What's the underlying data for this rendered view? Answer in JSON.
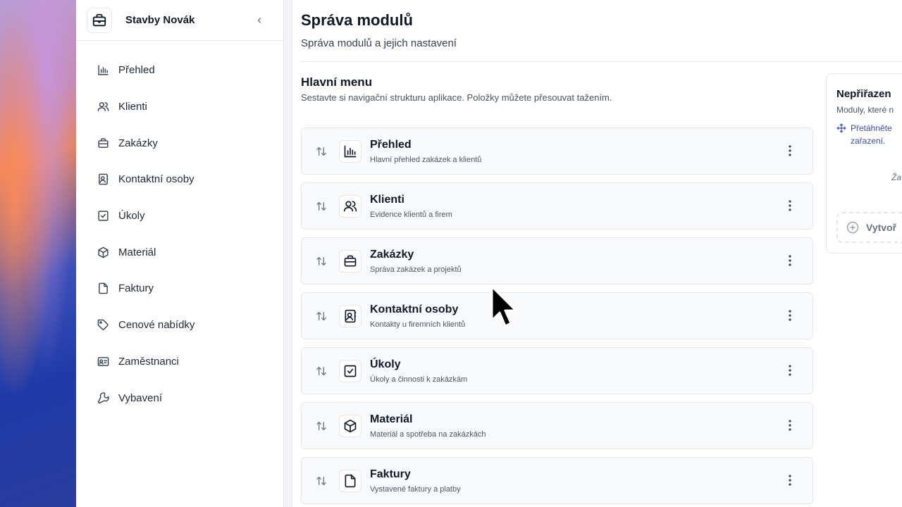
{
  "company": "Stavby Novák",
  "sidebar": {
    "items": [
      {
        "label": "Přehled",
        "icon": "chart-icon"
      },
      {
        "label": "Klienti",
        "icon": "users-icon"
      },
      {
        "label": "Zakázky",
        "icon": "briefcase-icon"
      },
      {
        "label": "Kontaktní osoby",
        "icon": "contact-book-icon"
      },
      {
        "label": "Úkoly",
        "icon": "checkbox-icon"
      },
      {
        "label": "Materiál",
        "icon": "box-icon"
      },
      {
        "label": "Faktury",
        "icon": "file-icon"
      },
      {
        "label": "Cenové nabídky",
        "icon": "tag-icon"
      },
      {
        "label": "Zaměstnanci",
        "icon": "id-card-icon"
      },
      {
        "label": "Vybavení",
        "icon": "wrench-icon"
      }
    ]
  },
  "page": {
    "title": "Správa modulů",
    "subtitle": "Správa modulů a jejich nastavení"
  },
  "main_menu": {
    "title": "Hlavní menu",
    "description": "Sestavte si navigační strukturu aplikace. Položky můžete přesouvat tažením.",
    "modules": [
      {
        "title": "Přehled",
        "description": "Hlavní přehled zakázek a klientů",
        "icon": "chart-icon"
      },
      {
        "title": "Klienti",
        "description": "Evidence klientů a firem",
        "icon": "users-icon"
      },
      {
        "title": "Zakázky",
        "description": "Správa zakázek a projektů",
        "icon": "briefcase-icon"
      },
      {
        "title": "Kontaktní osoby",
        "description": "Kontakty u firemních klientů",
        "icon": "contact-book-icon"
      },
      {
        "title": "Úkoly",
        "description": "Úkoly a činnosti k zakázkám",
        "icon": "checkbox-icon"
      },
      {
        "title": "Materiál",
        "description": "Materiál a spotřeba na zakázkách",
        "icon": "box-icon"
      },
      {
        "title": "Faktury",
        "description": "Vystavené faktury a platby",
        "icon": "file-icon"
      }
    ]
  },
  "unassigned": {
    "title": "Nepřiřazen",
    "description": "Moduly, které n",
    "hint_line1": "Přetáhněte",
    "hint_line2": "zařazení.",
    "empty": "Ža",
    "create_label": "Vytvoř"
  },
  "colors": {
    "accent": "#3b4fb0",
    "card_bg": "#f9fafb",
    "border": "#e5e7eb"
  }
}
